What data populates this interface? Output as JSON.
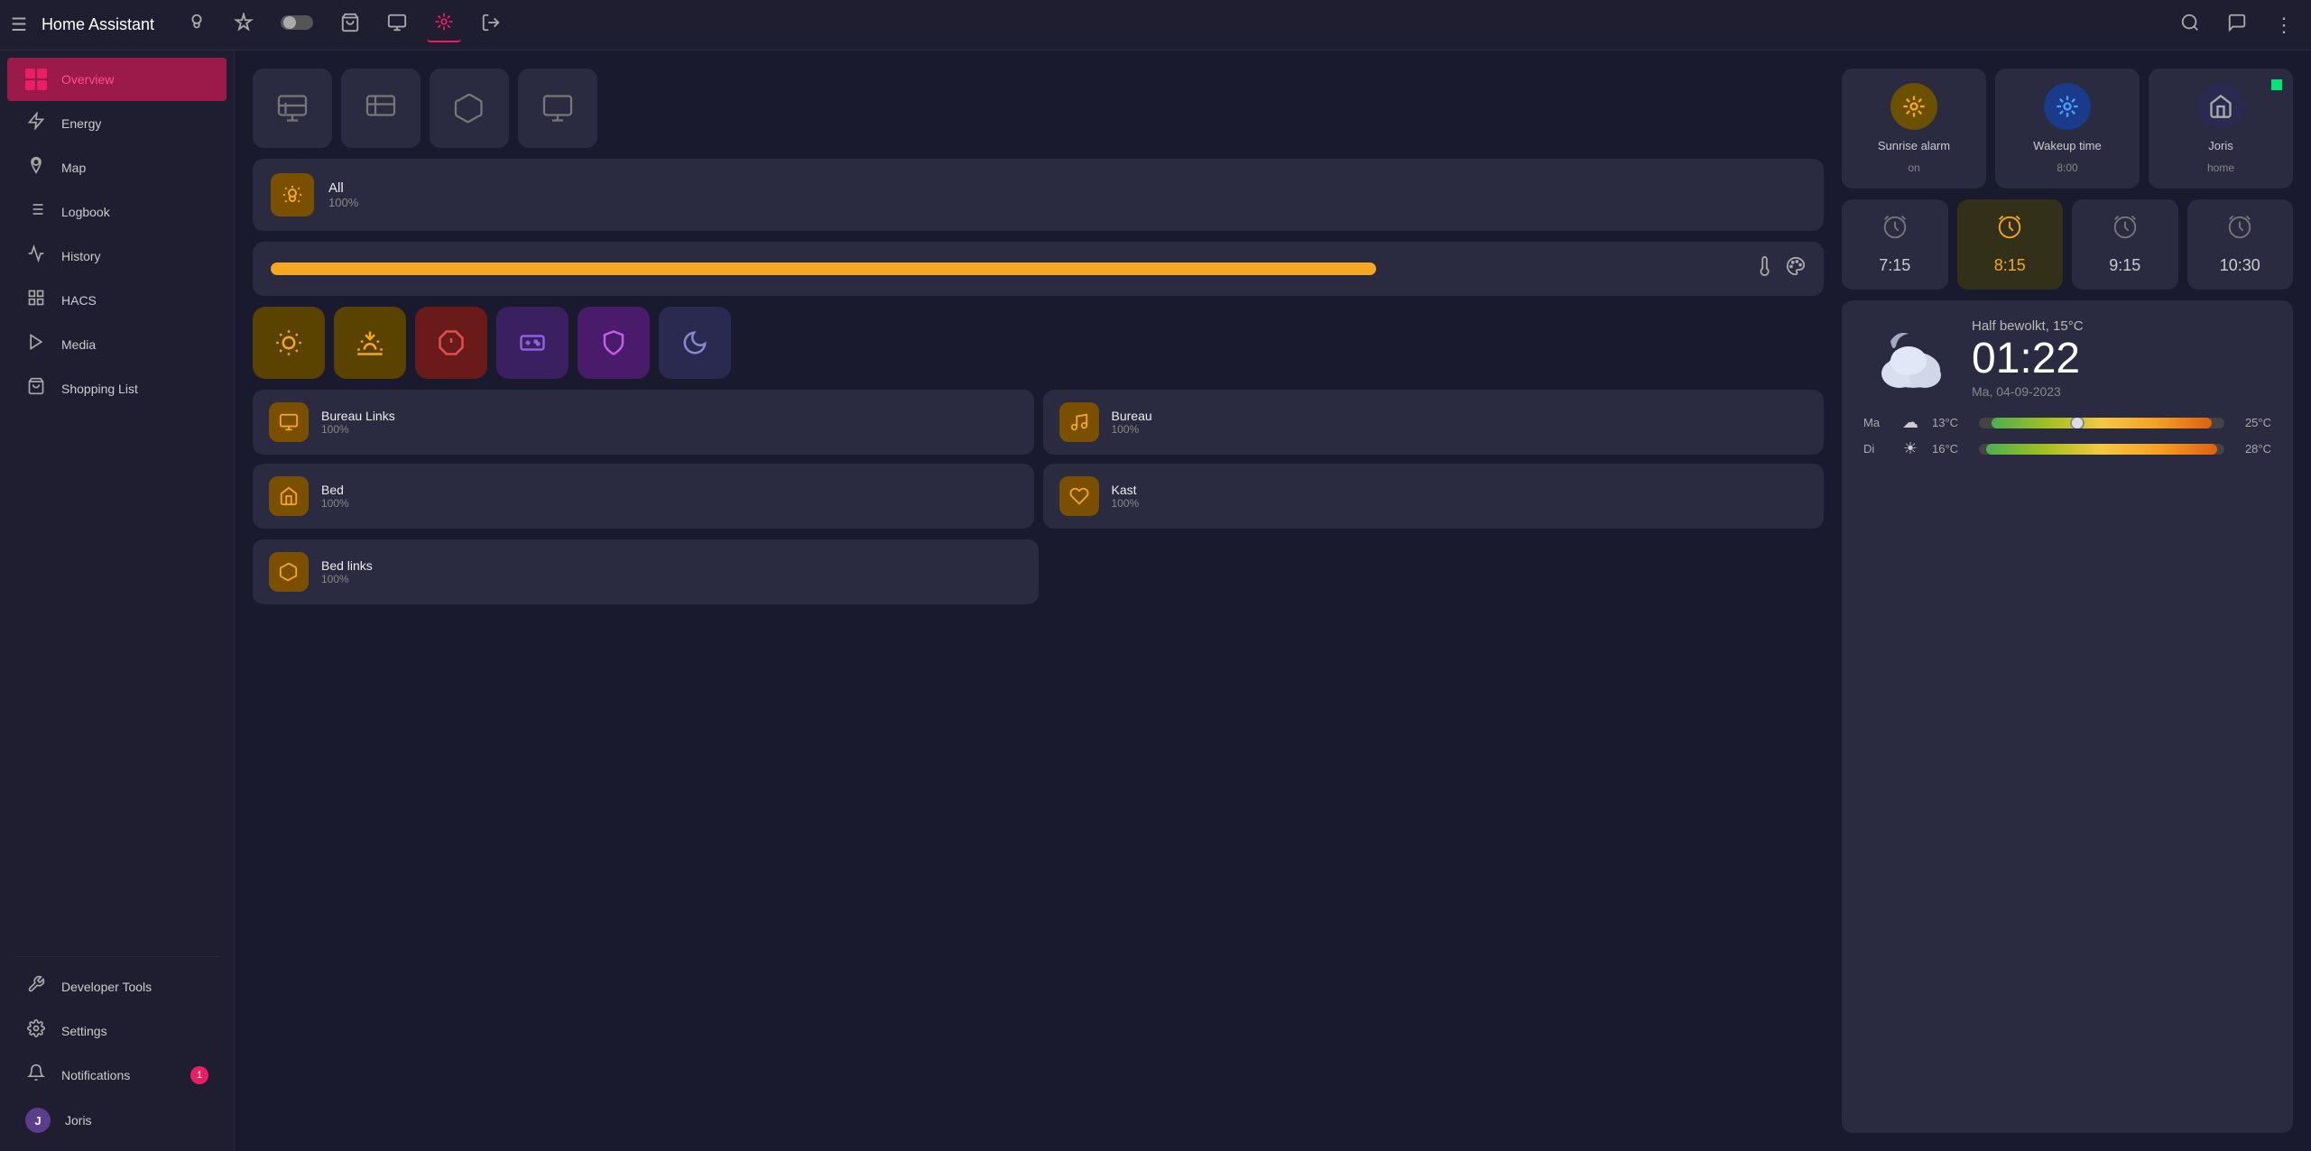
{
  "app": {
    "title": "Home Assistant",
    "menu_icon": "☰"
  },
  "top_nav": {
    "icons": [
      {
        "name": "bulb-icon",
        "symbol": "💡",
        "active": false
      },
      {
        "name": "automation-icon",
        "symbol": "⚙",
        "active": false
      },
      {
        "name": "toggle-icon",
        "symbol": "⬛",
        "active": false
      },
      {
        "name": "cart-icon",
        "symbol": "🛒",
        "active": false
      },
      {
        "name": "display-icon",
        "symbol": "🖥",
        "active": false
      },
      {
        "name": "hub-icon",
        "symbol": "⚙",
        "active": true
      },
      {
        "name": "exit-icon",
        "symbol": "↗",
        "active": false
      }
    ],
    "right_icons": [
      {
        "name": "search-icon",
        "symbol": "🔍"
      },
      {
        "name": "chat-icon",
        "symbol": "💬"
      },
      {
        "name": "more-icon",
        "symbol": "⋮"
      }
    ]
  },
  "sidebar": {
    "items": [
      {
        "id": "overview",
        "label": "Overview",
        "icon": "▦",
        "active": true
      },
      {
        "id": "energy",
        "label": "Energy",
        "icon": "⚡",
        "active": false
      },
      {
        "id": "map",
        "label": "Map",
        "icon": "👤",
        "active": false
      },
      {
        "id": "logbook",
        "label": "Logbook",
        "icon": "☰",
        "active": false
      },
      {
        "id": "history",
        "label": "History",
        "icon": "📊",
        "active": false
      },
      {
        "id": "hacs",
        "label": "HACS",
        "icon": "⬛",
        "active": false
      },
      {
        "id": "media",
        "label": "Media",
        "icon": "▶",
        "active": false
      },
      {
        "id": "shopping",
        "label": "Shopping List",
        "icon": "🛒",
        "active": false
      }
    ],
    "bottom_items": [
      {
        "id": "developer",
        "label": "Developer Tools",
        "icon": "🔧"
      },
      {
        "id": "settings",
        "label": "Settings",
        "icon": "⚙"
      }
    ],
    "notifications": {
      "label": "Notifications",
      "badge": "1"
    },
    "user": {
      "name": "Joris",
      "avatar_letter": "J"
    }
  },
  "main": {
    "scene_buttons": [
      {
        "name": "scene1",
        "icon": "📺"
      },
      {
        "name": "scene2",
        "icon": "📺"
      },
      {
        "name": "scene3",
        "icon": "📺"
      },
      {
        "name": "scene4",
        "icon": "📺"
      }
    ],
    "all_light": {
      "name": "All",
      "value": "100%",
      "icon": "💡",
      "icon_bg": "#7a4f00"
    },
    "scene_icons": [
      {
        "name": "morning-scene",
        "icon": "🌅",
        "bg": "#5a4200"
      },
      {
        "name": "sunrise-scene",
        "icon": "🌄",
        "bg": "#5a4200"
      },
      {
        "name": "alarm-scene",
        "icon": "🔴",
        "bg": "#6b1a1a"
      },
      {
        "name": "game-scene",
        "icon": "👾",
        "bg": "#3a2060"
      },
      {
        "name": "relax-scene",
        "icon": "🌸",
        "bg": "#4a1a6b"
      },
      {
        "name": "moon-scene",
        "icon": "🌙",
        "bg": "#2a2a50"
      }
    ],
    "light_cards": [
      {
        "name": "Bureau Links",
        "value": "100%",
        "icon": "💻",
        "icon_bg": "#7a4f00"
      },
      {
        "name": "Bureau",
        "value": "100%",
        "icon": "🔦",
        "icon_bg": "#7a4f00"
      },
      {
        "name": "Bed",
        "value": "100%",
        "icon": "💡",
        "icon_bg": "#7a4f00"
      },
      {
        "name": "Kast",
        "value": "100%",
        "icon": "💡",
        "icon_bg": "#7a4f00"
      }
    ],
    "bed_links": {
      "name": "Bed links",
      "value": "100%",
      "icon": "🔋",
      "icon_bg": "#7a4f00"
    }
  },
  "right_panel": {
    "top_alarms": [
      {
        "name": "Sunrise alarm",
        "status": "on",
        "icon": "⏰",
        "icon_bg": "#6b5000",
        "icon_color": "#f5a623"
      },
      {
        "name": "Wakeup time",
        "status": "8:00",
        "icon": "⏰",
        "icon_bg": "#1a3a8a",
        "icon_color": "#4a9eff"
      },
      {
        "name": "Joris",
        "status": "home",
        "icon": "🏠",
        "icon_bg": "#2a2a40",
        "icon_color": "#aaa",
        "has_dot": true
      }
    ],
    "time_alarms": [
      {
        "time": "7:15",
        "icon": "⏰"
      },
      {
        "time": "8:15",
        "icon": "⏰",
        "active": true,
        "icon_bg": "#6b5000"
      },
      {
        "time": "9:15",
        "icon": "⏰"
      },
      {
        "time": "10:30",
        "icon": "⏰"
      }
    ],
    "weather": {
      "description": "Half bewolkt, 15°C",
      "time": "01:22",
      "date": "Ma, 04-09-2023",
      "forecast": [
        {
          "day": "Ma",
          "icon": "☁",
          "low": "13°C",
          "high": "25°C",
          "bar_low_pct": 0,
          "bar_high_pct": 75,
          "marker_pct": 40,
          "bar_color": "linear-gradient(to right, #4caf50, #a0c020, #f5c842, #f5a023, #e06010)"
        },
        {
          "day": "Di",
          "icon": "☀",
          "low": "16°C",
          "high": "28°C",
          "bar_low_pct": 10,
          "bar_high_pct": 90,
          "marker_pct": -1,
          "bar_color": "linear-gradient(to right, #4caf50, #a0c020, #f5c842, #f5a023, #e06010)"
        }
      ]
    }
  }
}
